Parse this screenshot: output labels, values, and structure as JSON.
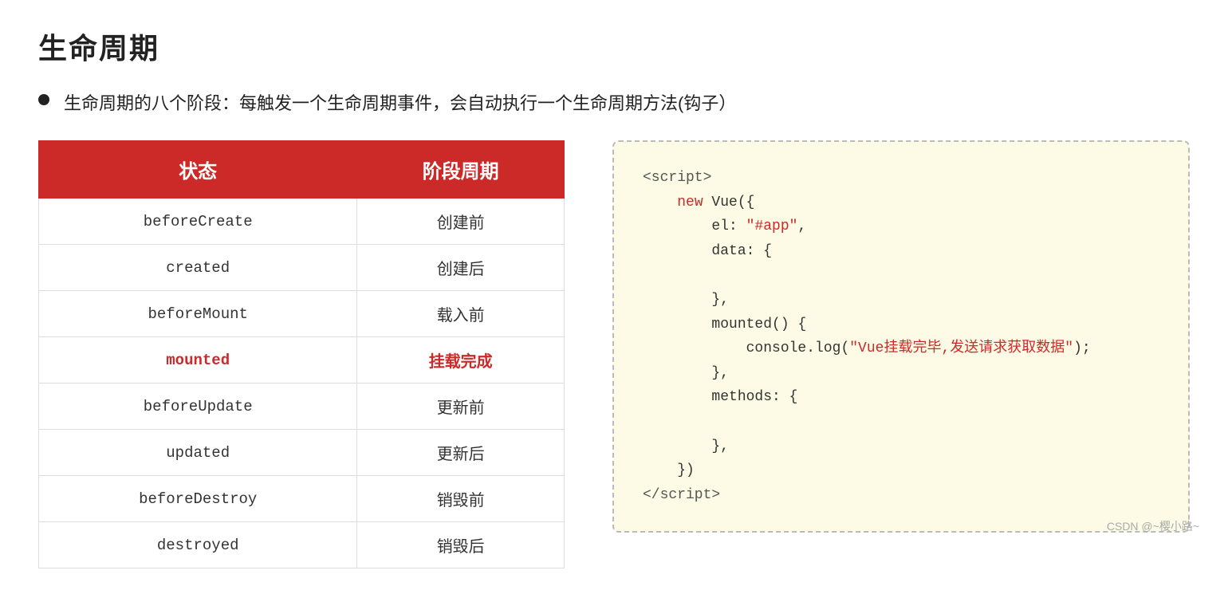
{
  "page": {
    "title": "生命周期",
    "subtitle": "生命周期的八个阶段：每触发一个生命周期事件，会自动执行一个生命周期方法(钩子）"
  },
  "table": {
    "col1_header": "状态",
    "col2_header": "阶段周期",
    "rows": [
      {
        "state": "beforeCreate",
        "phase": "创建前",
        "highlighted": false
      },
      {
        "state": "created",
        "phase": "创建后",
        "highlighted": false
      },
      {
        "state": "beforeMount",
        "phase": "载入前",
        "highlighted": false
      },
      {
        "state": "mounted",
        "phase": "挂载完成",
        "highlighted": true
      },
      {
        "state": "beforeUpdate",
        "phase": "更新前",
        "highlighted": false
      },
      {
        "state": "updated",
        "phase": "更新后",
        "highlighted": false
      },
      {
        "state": "beforeDestroy",
        "phase": "销毁前",
        "highlighted": false
      },
      {
        "state": "destroyed",
        "phase": "销毁后",
        "highlighted": false
      }
    ]
  },
  "code": {
    "script_open": "<script>",
    "script_close": "</script>",
    "new_keyword": "new",
    "vue_constructor": " Vue({",
    "el_key": "    el: ",
    "el_value": "\"#app\",",
    "data_key": "    data: {",
    "data_close": "    },",
    "mounted_func": "    mounted() {",
    "console_log": "        console.log(",
    "console_string": "\"Vue挂载完毕,发送请求获取数据\"",
    "console_end": ");",
    "mounted_close": "    },",
    "methods_key": "    methods: {",
    "methods_close": "    },",
    "vue_close": "})",
    "indent1": "    ",
    "indent2": "        "
  },
  "footer": {
    "watermark": "CSDN @~樱小路~"
  }
}
